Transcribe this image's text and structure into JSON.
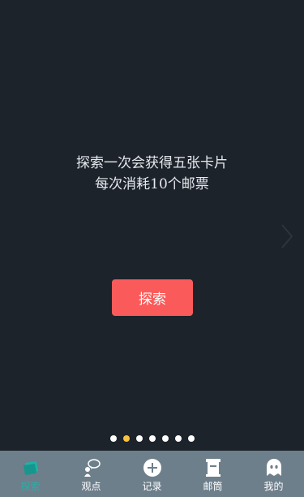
{
  "hero": {
    "line1": "探索一次会获得五张卡片",
    "line2": "每次消耗10个邮票"
  },
  "explore_button": {
    "label": "探索"
  },
  "carousel": {
    "page_count": 7,
    "active_index": 1
  },
  "tabbar": {
    "items": [
      {
        "label": "探索",
        "icon": "explore-icon",
        "active": true
      },
      {
        "label": "观点",
        "icon": "opinion-icon",
        "active": false
      },
      {
        "label": "记录",
        "icon": "add-record-icon",
        "active": false
      },
      {
        "label": "邮筒",
        "icon": "mailbox-icon",
        "active": false
      },
      {
        "label": "我的",
        "icon": "profile-icon",
        "active": false
      }
    ]
  },
  "colors": {
    "background": "#1d232b",
    "button": "#fa5b5a",
    "tabbar": "#6e7f8c",
    "active_tab": "#1fb2a8",
    "active_dot": "#f5c242"
  }
}
